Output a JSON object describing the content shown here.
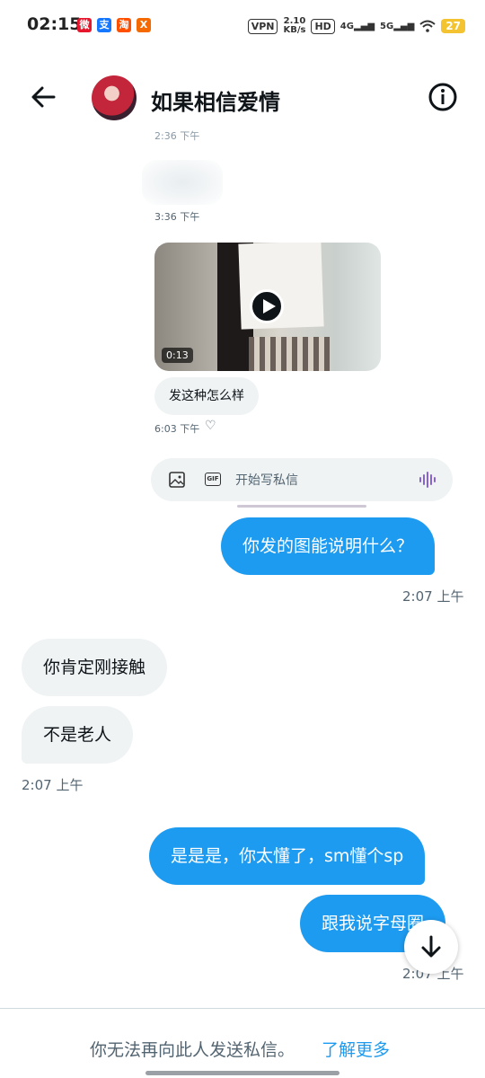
{
  "status_bar": {
    "time": "02:15",
    "apps": [
      "weibo-icon",
      "alipay-icon",
      "taobao-icon",
      "app-icon"
    ],
    "vpn": "VPN",
    "speed_value": "2.10",
    "speed_unit": "KB/s",
    "hd": "HD",
    "net1": "4G",
    "net2": "5G",
    "battery": "27",
    "battery_color": "#f3c332"
  },
  "header": {
    "title": "如果相信爱情",
    "back_icon": "arrow-left-icon",
    "info_icon": "info-icon"
  },
  "embedded": {
    "partial_time": "2:36 下午",
    "time1": "3:36 下午",
    "video_duration": "0:13",
    "message": "发这种怎么样",
    "time2": "6:03 下午",
    "composer_placeholder": "开始写私信"
  },
  "messages": [
    {
      "side": "out",
      "text": "你发的图能说明什么？",
      "time": "2:07 上午"
    },
    {
      "side": "in",
      "text": "你肯定刚接触"
    },
    {
      "side": "in",
      "text": "不是老人",
      "time": "2:07 上午"
    },
    {
      "side": "out",
      "text": "是是是，你太懂了，sm懂个sp"
    },
    {
      "side": "out",
      "text": "跟我说字母圈",
      "time": "2:07 上午"
    }
  ],
  "footer": {
    "text": "你无法再向此人发送私信。",
    "link": "了解更多"
  },
  "colors": {
    "accent": "#1d9bf0",
    "incoming_bubble": "#eff3f4",
    "secondary_text": "#536471"
  }
}
